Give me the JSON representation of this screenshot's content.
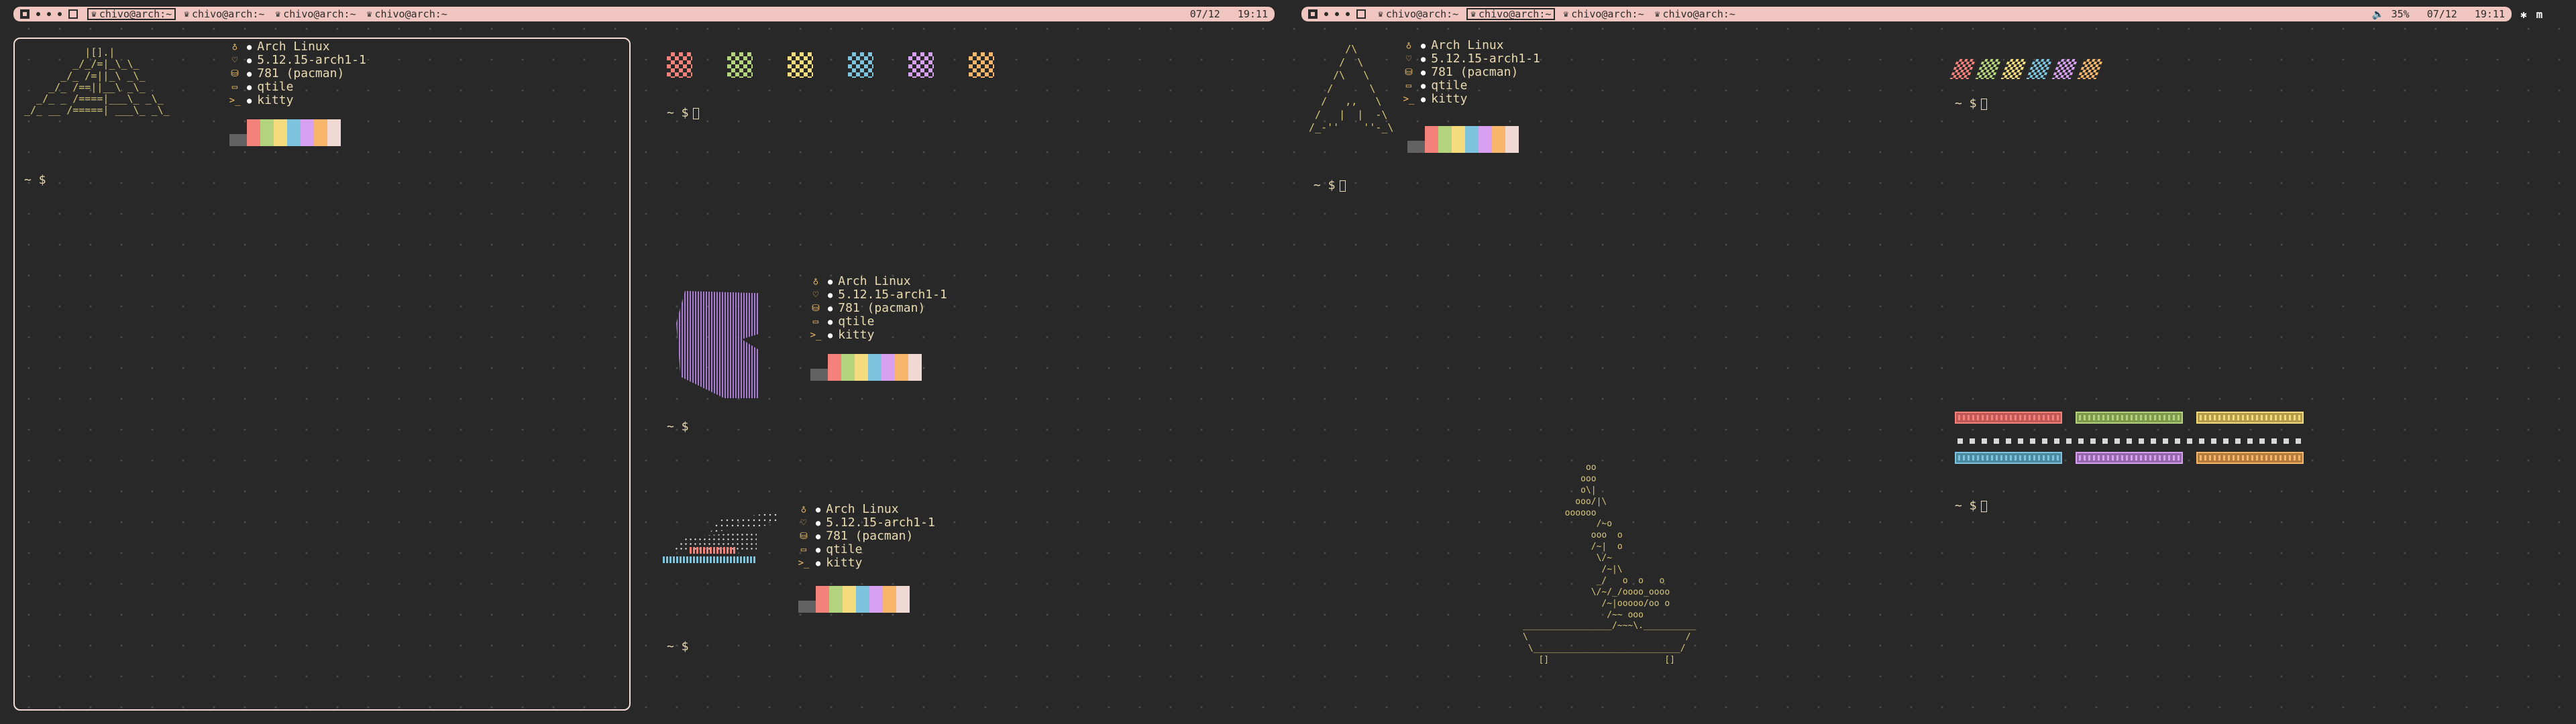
{
  "colors": {
    "red": "#f4817a",
    "green": "#b4d37d",
    "yellow": "#f4db7d",
    "blue": "#7ec3dd",
    "magenta": "#d7a0f0",
    "orange": "#f8b66c",
    "light": "#f0d8d3",
    "gray": "#626262"
  },
  "bar_left": {
    "tasks": [
      {
        "label": "chivo@arch:~",
        "active": true
      },
      {
        "label": "chivo@arch:~",
        "active": false
      },
      {
        "label": "chivo@arch:~",
        "active": false
      },
      {
        "label": "chivo@arch:~",
        "active": false
      }
    ],
    "date": "07/12",
    "time": "19:11"
  },
  "bar_right": {
    "tasks": [
      {
        "label": "chivo@arch:~",
        "active": false
      },
      {
        "label": "chivo@arch:~",
        "active": true
      },
      {
        "label": "chivo@arch:~",
        "active": false
      },
      {
        "label": "chivo@arch:~",
        "active": false
      }
    ],
    "volume": "35%",
    "date": "07/12",
    "time": "19:11"
  },
  "tray": {
    "bluetooth_icon": "bluetooth-icon",
    "app_icon": "m"
  },
  "fetch": {
    "os": "Arch Linux",
    "kernel": "5.12.15-arch1-1",
    "packages": "781 (pacman)",
    "wm": "qtile",
    "term": "kitty"
  },
  "prompt": "~ $",
  "ascii": {
    "pyramid": "          |[].|\n        _/_/=|_\\_\\_\n      _/_ /=||_\\ _\\_\n    _/_ /==||__\\ _\\_\n  _/_ _ /====|___\\_ _\\_\n_/_ __ /=====| ___\\_ _\\_\n",
    "arch": "       /\\\n      /  \\\n     /\\   \\\n    /      \\\n   /   ,,   \\\n  /   |  |  -\\\n /_-''    ''-_\\",
    "tub": "            oo\n           ooo\n           o\\|\n          ooo/|\\\n        oooooo\n              /~o\n             ooo  o\n             /~|  o\n              \\/~\n               /~|\\\n              _/   o  o   o\n             \\/~/_/oooo_oooo\n               /~|ooooo/oo o\n                /~~ ooo\n_________________/~~~\\.__________\n\\                              /\n \\____________________________/\n   []                      []"
  }
}
